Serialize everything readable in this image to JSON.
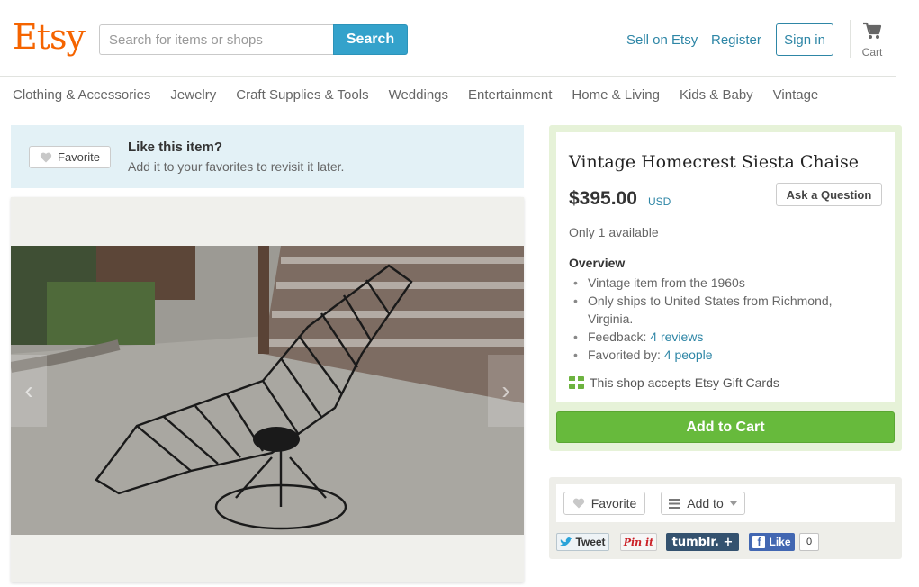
{
  "header": {
    "logo": "Etsy",
    "search": {
      "placeholder": "Search for items or shops",
      "value": "",
      "button": "Search"
    },
    "links": {
      "sell": "Sell on Etsy",
      "register": "Register",
      "signin": "Sign in"
    },
    "cart_label": "Cart"
  },
  "nav": [
    "Clothing & Accessories",
    "Jewelry",
    "Craft Supplies & Tools",
    "Weddings",
    "Entertainment",
    "Home & Living",
    "Kids & Baby",
    "Vintage"
  ],
  "favorite_banner": {
    "button": "Favorite",
    "title": "Like this item?",
    "subtitle": "Add it to your favorites to revisit it later."
  },
  "gallery": {
    "prev_icon": "‹",
    "next_icon": "›"
  },
  "listing": {
    "title": "Vintage Homecrest Siesta Chaise",
    "price": "$395.00",
    "currency": "USD",
    "ask_button": "Ask a Question",
    "availability": "Only 1 available",
    "overview_title": "Overview",
    "overview": {
      "item1": "Vintage item from the 1960s",
      "item2": "Only ships to United States from Richmond, Virginia.",
      "feedback_label": "Feedback: ",
      "feedback_link": "4 reviews",
      "favorited_label": "Favorited by: ",
      "favorited_link": "4 people"
    },
    "gift_cards": "This shop accepts Etsy Gift Cards",
    "add_to_cart": "Add to Cart"
  },
  "share": {
    "favorite": "Favorite",
    "add_to": "Add to",
    "tweet": "Tweet",
    "pin": "Pin it",
    "tumblr": "tumblr. +",
    "fb_like": "Like",
    "fb_count": "0"
  },
  "colors": {
    "brand": "#f56400",
    "link": "#2e86a6",
    "search_button": "#34a2cb",
    "add_to_cart": "#67ba3c",
    "listing_border": "#e6f2d8",
    "banner_bg": "#e3f1f6"
  }
}
